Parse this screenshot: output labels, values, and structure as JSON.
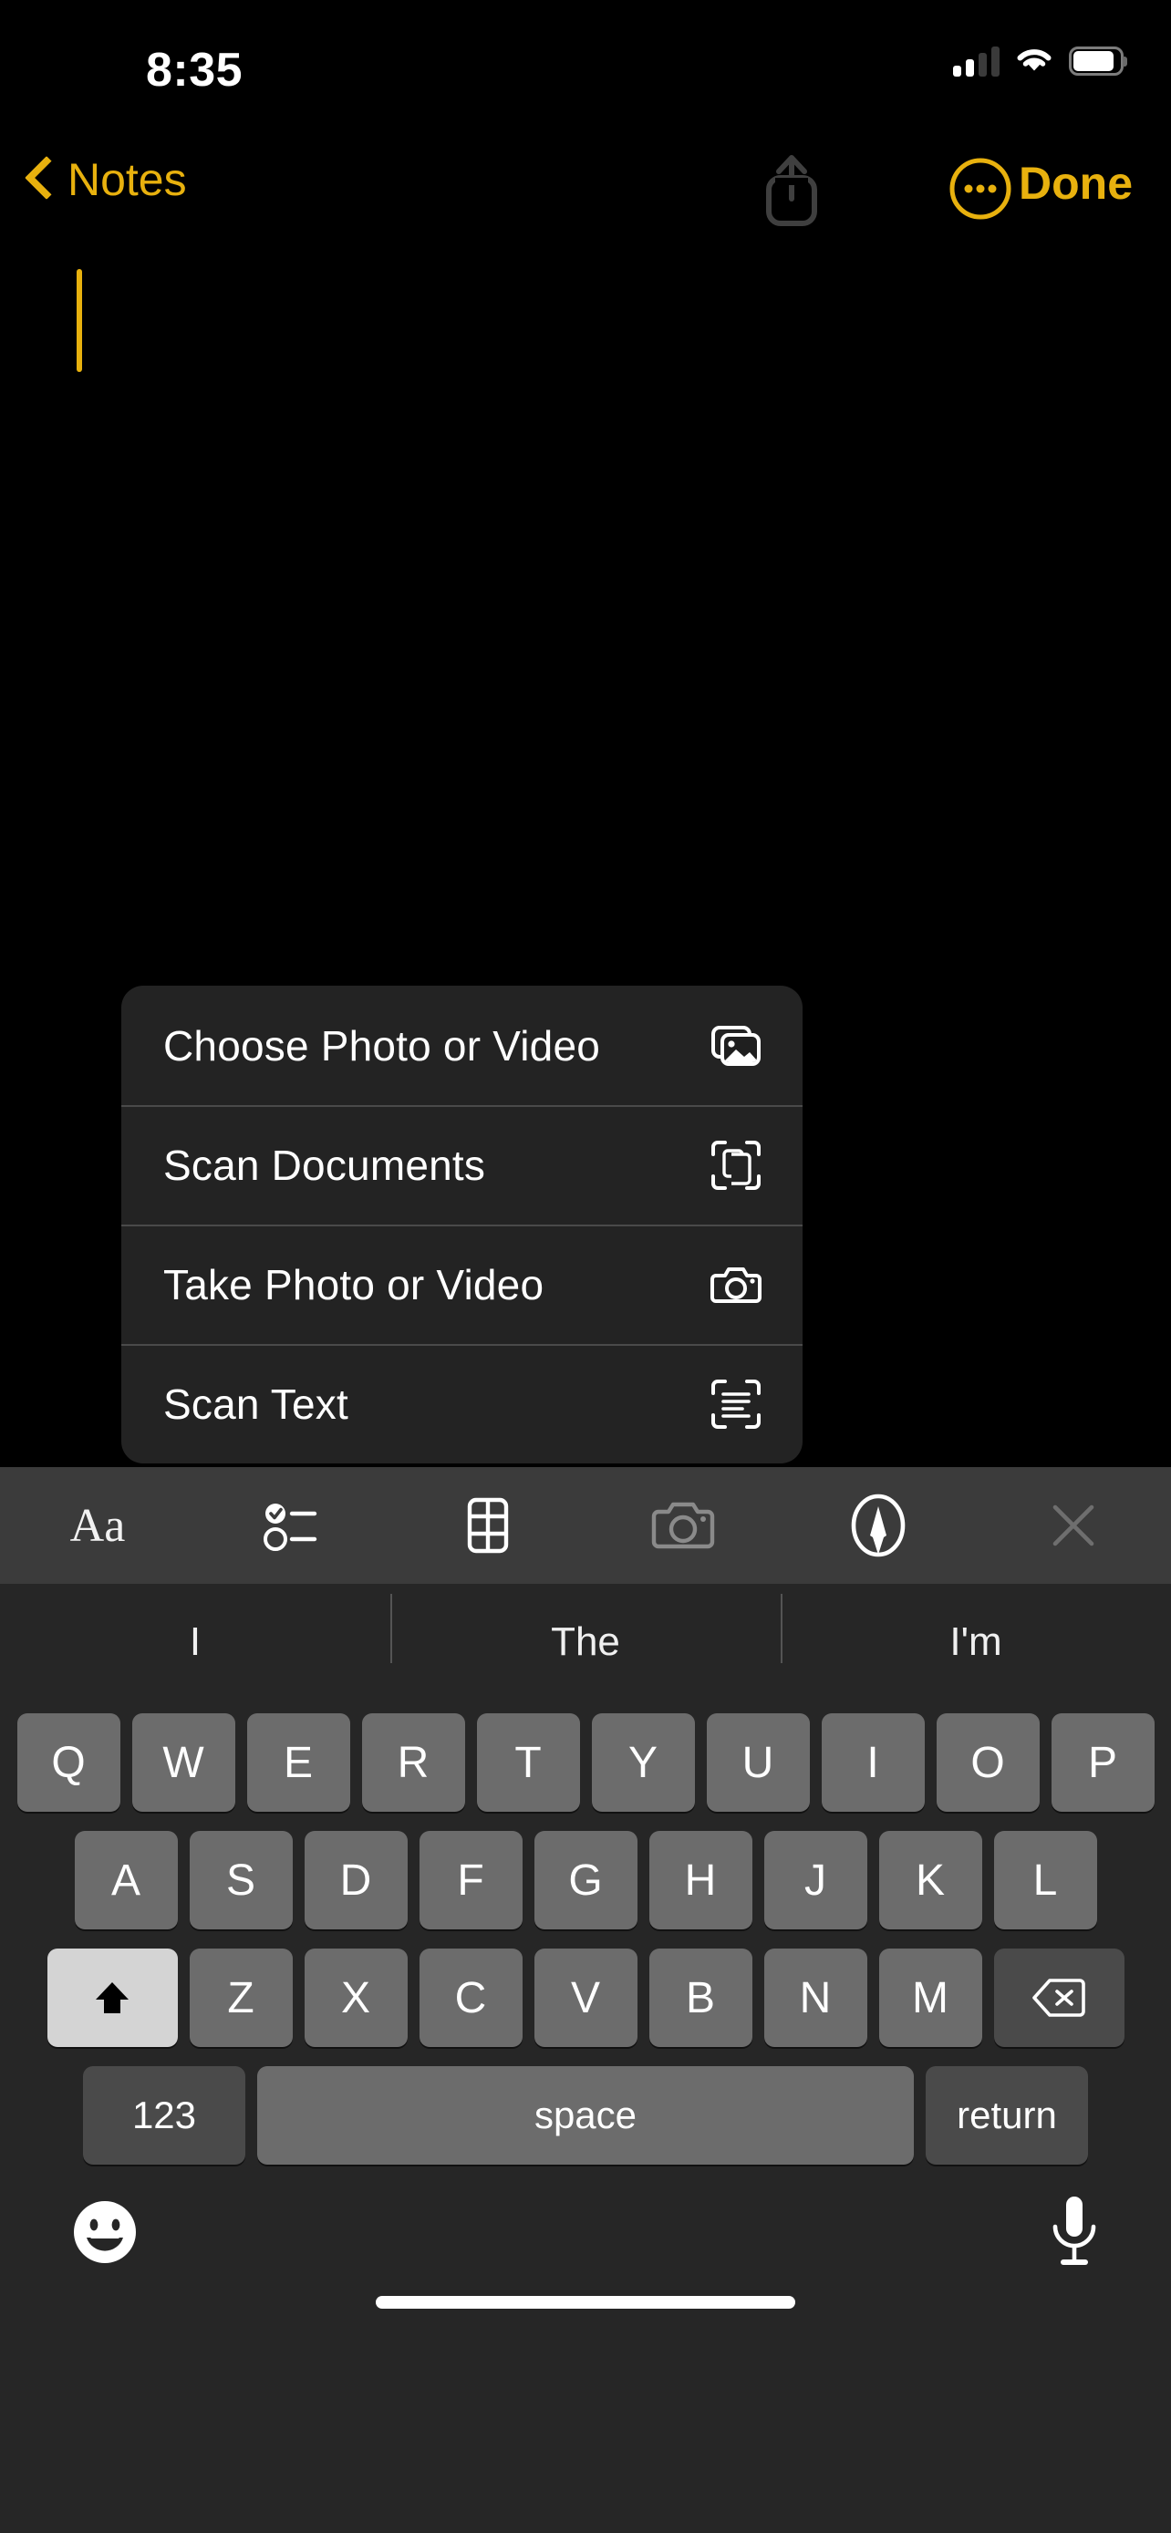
{
  "status_bar": {
    "time": "8:35",
    "cellular_icon": "cellular-signal-icon",
    "cellular_bars_active": 2,
    "cellular_bars_total": 4,
    "wifi_icon": "wifi-icon",
    "battery_icon": "battery-icon",
    "battery_level_percent": 88
  },
  "nav_bar": {
    "back_label": "Notes",
    "back_icon": "chevron-left-icon",
    "share_icon": "share-icon",
    "share_enabled": false,
    "more_icon": "ellipsis-circle-icon",
    "done_label": "Done",
    "accent_color": "#E8B10E",
    "dim_color": "#3f3f3f"
  },
  "note": {
    "body_text": "",
    "caret_color": "#E8B10E",
    "background_color": "#000000"
  },
  "context_menu": {
    "background_color": "#232323",
    "items": [
      {
        "label": "Choose Photo or Video",
        "icon": "photo-stack-icon"
      },
      {
        "label": "Scan Documents",
        "icon": "scan-document-icon"
      },
      {
        "label": "Take Photo or Video",
        "icon": "camera-icon"
      },
      {
        "label": "Scan Text",
        "icon": "scan-text-icon"
      }
    ]
  },
  "format_toolbar": {
    "background_color": "#3b3b3b",
    "items": [
      {
        "name": "format-text",
        "label": "Aa",
        "icon": "aa-text-format-icon",
        "state": "enabled"
      },
      {
        "name": "checklist",
        "label": "",
        "icon": "checklist-icon",
        "state": "enabled"
      },
      {
        "name": "table",
        "label": "",
        "icon": "table-icon",
        "state": "enabled"
      },
      {
        "name": "camera",
        "label": "",
        "icon": "camera-icon",
        "state": "dimmed"
      },
      {
        "name": "markup",
        "label": "",
        "icon": "markup-pen-circle-icon",
        "state": "active"
      },
      {
        "name": "close-keyboard",
        "label": "",
        "icon": "close-x-icon",
        "state": "dimmed"
      }
    ]
  },
  "keyboard": {
    "background_color": "#262626",
    "key_color": "#6c6c6c",
    "special_key_color": "#4a4a4a",
    "shift_active": true,
    "predictions": [
      "I",
      "The",
      "I'm"
    ],
    "row1": [
      "Q",
      "W",
      "E",
      "R",
      "T",
      "Y",
      "U",
      "I",
      "O",
      "P"
    ],
    "row2": [
      "A",
      "S",
      "D",
      "F",
      "G",
      "H",
      "J",
      "K",
      "L"
    ],
    "row3_letters": [
      "Z",
      "X",
      "C",
      "V",
      "B",
      "N",
      "M"
    ],
    "shift_icon": "shift-up-arrow-icon",
    "backspace_icon": "backspace-delete-icon",
    "numeric_label": "123",
    "space_label": "space",
    "return_label": "return",
    "emoji_icon": "emoji-smiley-icon",
    "dictation_icon": "microphone-icon"
  },
  "home_indicator": {
    "name": "home-indicator"
  }
}
